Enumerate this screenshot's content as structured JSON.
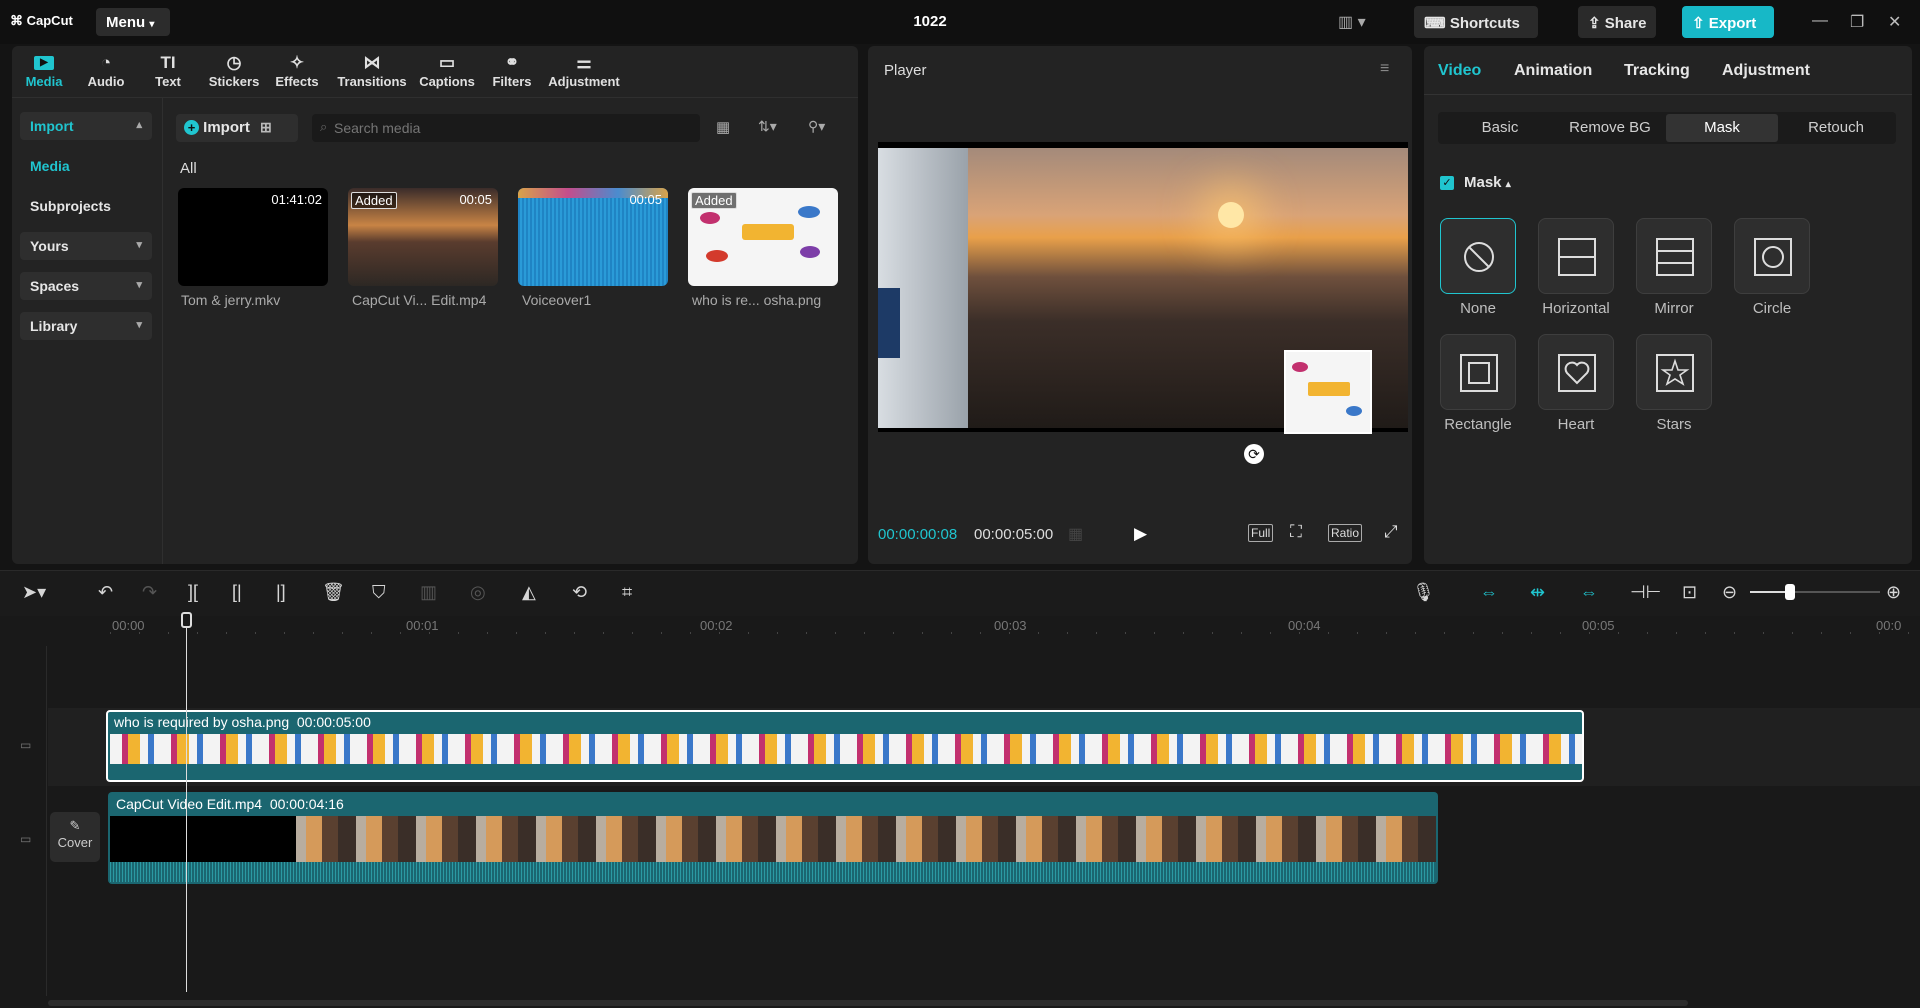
{
  "app": {
    "logo": "CapCut",
    "menu_label": "Menu",
    "project_title": "1022",
    "shortcuts_label": "Shortcuts",
    "share_label": "Share",
    "export_label": "Export"
  },
  "toolbar": {
    "tabs": [
      {
        "label": "Media",
        "icon": "media-icon"
      },
      {
        "label": "Audio",
        "icon": "audio-icon"
      },
      {
        "label": "Text",
        "icon": "text-icon"
      },
      {
        "label": "Stickers",
        "icon": "stickers-icon"
      },
      {
        "label": "Effects",
        "icon": "effects-icon"
      },
      {
        "label": "Transitions",
        "icon": "transitions-icon"
      },
      {
        "label": "Captions",
        "icon": "captions-icon"
      },
      {
        "label": "Filters",
        "icon": "filters-icon"
      },
      {
        "label": "Adjustment",
        "icon": "adjustment-icon"
      }
    ]
  },
  "sidebar": {
    "items": [
      {
        "label": "Import"
      },
      {
        "label": "Media"
      },
      {
        "label": "Subprojects"
      },
      {
        "label": "Yours"
      },
      {
        "label": "Spaces"
      },
      {
        "label": "Library"
      }
    ]
  },
  "media": {
    "import_label": "Import",
    "search_placeholder": "Search media",
    "section_label": "All",
    "items": [
      {
        "name": "Tom & jerry.mkv",
        "duration": "01:41:02",
        "badge": ""
      },
      {
        "name": "CapCut Vi... Edit.mp4",
        "duration": "00:05",
        "badge": "Added"
      },
      {
        "name": "Voiceover1",
        "duration": "00:05",
        "badge": ""
      },
      {
        "name": "who is re... osha.png",
        "duration": "",
        "badge": "Added"
      }
    ]
  },
  "player": {
    "title": "Player",
    "current_time": "00:00:00:08",
    "total_time": "00:00:05:00",
    "full_label": "Full",
    "ratio_label": "Ratio"
  },
  "inspector": {
    "tabs": [
      "Video",
      "Animation",
      "Tracking",
      "Adjustment"
    ],
    "subtabs": [
      "Basic",
      "Remove BG",
      "Mask",
      "Retouch"
    ],
    "mask_title": "Mask",
    "mask_options": [
      {
        "label": "None"
      },
      {
        "label": "Horizontal"
      },
      {
        "label": "Mirror"
      },
      {
        "label": "Circle"
      },
      {
        "label": "Rectangle"
      },
      {
        "label": "Heart"
      },
      {
        "label": "Stars"
      }
    ]
  },
  "timeline": {
    "ruler": [
      "00:00",
      "00:01",
      "00:02",
      "00:03",
      "00:04",
      "00:05",
      "00:0"
    ],
    "clip_top": {
      "name": "who is required by osha.png",
      "duration": "00:00:05:00"
    },
    "clip_main": {
      "name": "CapCut Video Edit.mp4",
      "duration": "00:00:04:16"
    },
    "cover_label": "Cover"
  },
  "colors": {
    "accent": "#20c5cf",
    "export": "#17b8c7",
    "clip_bg": "#1b6670"
  }
}
